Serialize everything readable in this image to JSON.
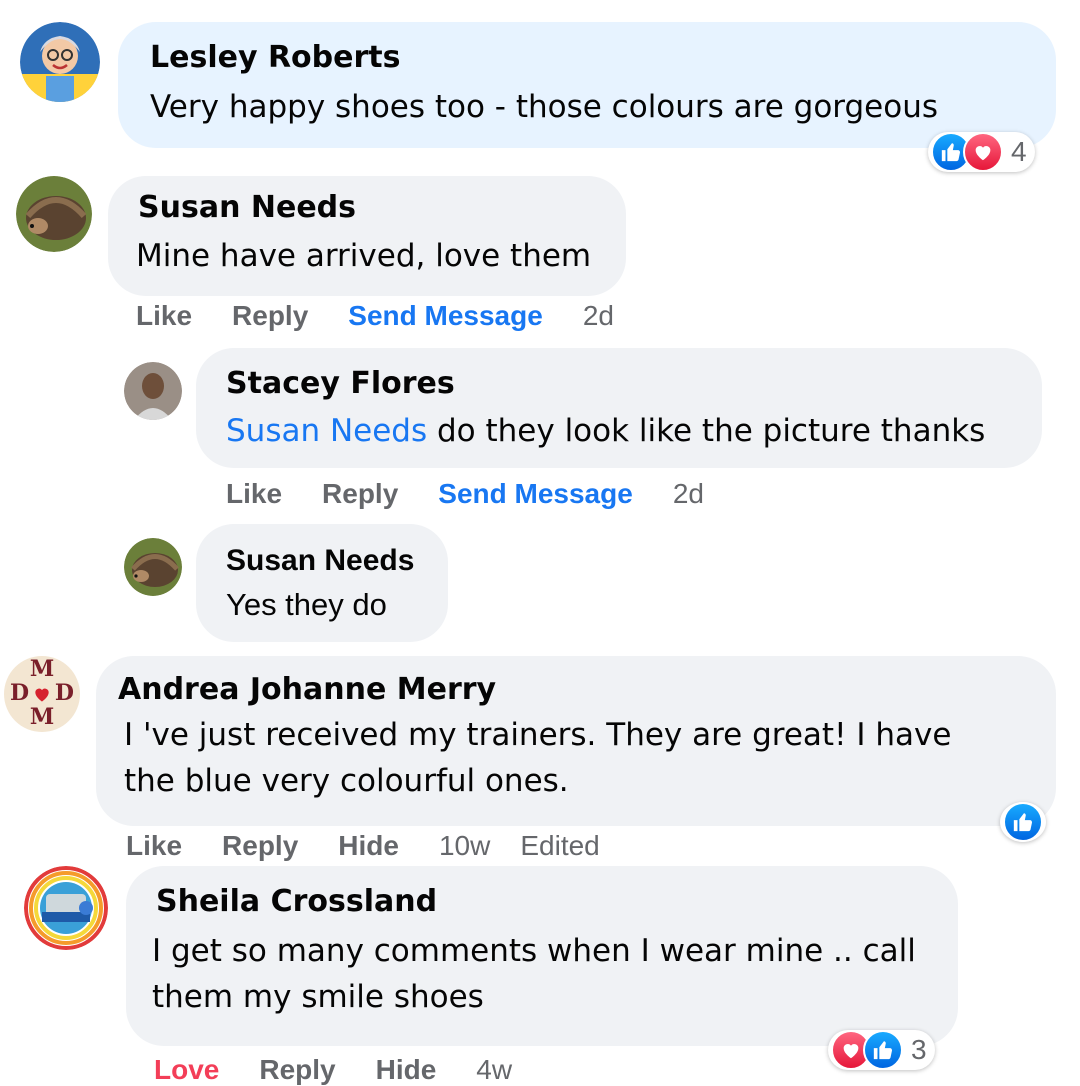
{
  "comments": [
    {
      "name": "Lesley Roberts",
      "text": "Very happy shoes too - those colours are gorgeous",
      "reaction_count": "4"
    },
    {
      "name": "Susan Needs",
      "text": "Mine have arrived, love them",
      "actions": {
        "like": "Like",
        "reply": "Reply",
        "send": "Send Message",
        "time": "2d"
      }
    },
    {
      "name": "Stacey Flores",
      "mention": "Susan Needs",
      "text": " do they look like the picture thanks",
      "actions": {
        "like": "Like",
        "reply": "Reply",
        "send": "Send Message",
        "time": "2d"
      }
    },
    {
      "name": "Susan Needs",
      "text": "Yes they do"
    },
    {
      "name": "Andrea Johanne Merry",
      "text": "I 've just received my trainers. They are great! I have the blue very colourful ones.",
      "actions": {
        "like": "Like",
        "reply": "Reply",
        "hide": "Hide",
        "time": "10w",
        "edited": "Edited"
      },
      "avatar_letters": {
        "top": "M",
        "left": "D",
        "right": "D",
        "bottom": "M"
      }
    },
    {
      "name": "Sheila Crossland",
      "text": "I get so many comments when I wear mine .. call them my smile shoes",
      "actions": {
        "love": "Love",
        "reply": "Reply",
        "hide": "Hide",
        "time": "4w"
      },
      "reaction_count": "3"
    }
  ],
  "colors": {
    "bubble": "#f0f2f5",
    "bubble_highlight": "#e7f3ff",
    "link_blue": "#1877f2",
    "meta_gray": "#65676b",
    "love_red": "#f33e58"
  },
  "icons": [
    "like-icon",
    "love-icon"
  ]
}
